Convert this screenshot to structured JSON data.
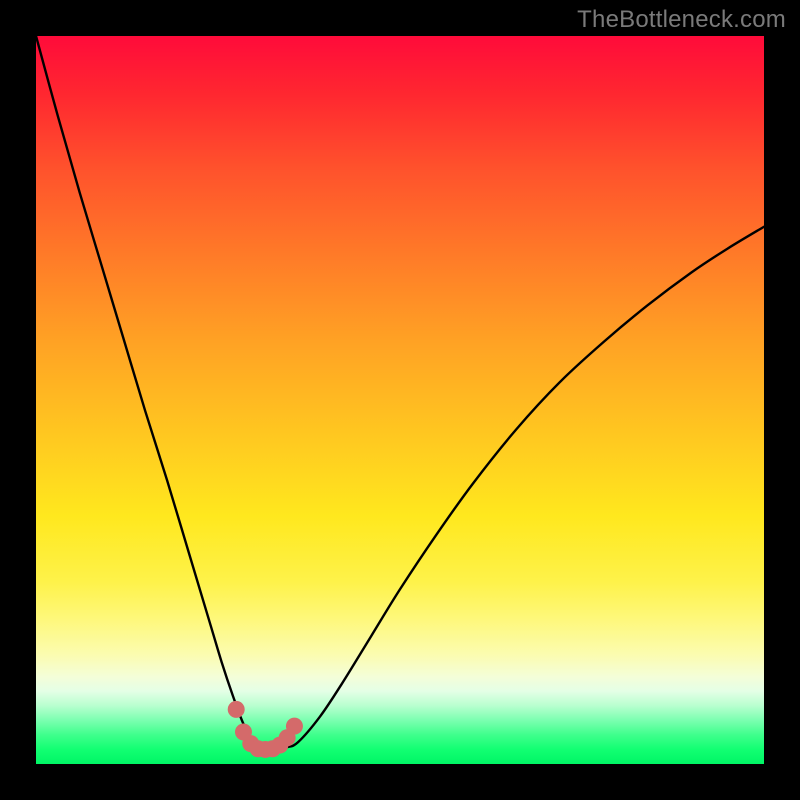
{
  "watermark": "TheBottleneck.com",
  "colors": {
    "page_bg": "#000000",
    "watermark": "#7a7a7a",
    "curve_stroke": "#000000",
    "marker_fill": "#d46a6a",
    "marker_stroke": "#b24f4f"
  },
  "chart_data": {
    "type": "line",
    "title": "",
    "xlabel": "",
    "ylabel": "",
    "xlim": [
      0,
      100
    ],
    "ylim": [
      0,
      100
    ],
    "series": [
      {
        "name": "bottleneck-curve",
        "x": [
          0,
          3,
          6,
          9,
          12,
          15,
          18,
          21,
          24,
          25.5,
          27,
          28.5,
          30,
          31.5,
          33,
          34.5,
          36,
          39,
          42,
          46,
          50,
          55,
          60,
          66,
          72,
          78,
          84,
          90,
          95,
          100
        ],
        "y": [
          100,
          89,
          78.5,
          68.5,
          58.5,
          48.5,
          39,
          29,
          19,
          14,
          9.5,
          5.5,
          3,
          2,
          2,
          2.3,
          3,
          6.5,
          11,
          17.5,
          24,
          31.5,
          38.5,
          46,
          52.5,
          58,
          63,
          67.5,
          70.8,
          73.8
        ]
      }
    ],
    "markers": {
      "name": "highlight-points",
      "x": [
        27.5,
        28.5,
        29.5,
        30.5,
        31.5,
        32.5,
        33.5,
        34.5,
        35.5
      ],
      "y": [
        7.5,
        4.4,
        2.8,
        2.1,
        2.0,
        2.1,
        2.6,
        3.6,
        5.2
      ]
    }
  }
}
